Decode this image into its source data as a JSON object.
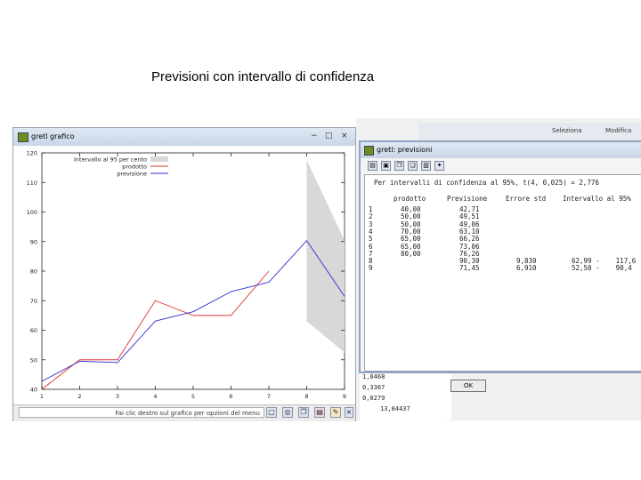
{
  "slide": {
    "title": "Previsioni con intervallo di confidenza"
  },
  "background_app": {
    "toolbar_items": [
      "Seleziona",
      "Modifica"
    ],
    "console_lines": [
      "1,0468",
      "0,3367",
      "0,0279",
      "13,84437"
    ]
  },
  "graph_window": {
    "title": "gretl grafico",
    "status_text": "Fai clic destro sul grafico per opzioni del menu",
    "window_controls": [
      "−",
      "□",
      "×"
    ],
    "toolbar_icons": [
      "zoom-icon",
      "crosshair-icon",
      "copy-icon",
      "pdf-icon",
      "edit-icon",
      "close-icon"
    ]
  },
  "chart_data": {
    "type": "line",
    "x": [
      1,
      2,
      3,
      4,
      5,
      6,
      7,
      8,
      9
    ],
    "xlim": [
      1,
      9
    ],
    "ylim": [
      40,
      120
    ],
    "xticks": [
      "1",
      "2",
      "3",
      "4",
      "5",
      "6",
      "7",
      "8",
      "9"
    ],
    "yticks": [
      "40",
      "50",
      "60",
      "70",
      "80",
      "90",
      "100",
      "110",
      "120"
    ],
    "legend": [
      "Intervallo al 95 per cento",
      "prodotto",
      "previsione"
    ],
    "legend_position": "top-left",
    "series": [
      {
        "name": "prodotto",
        "color": "#e03030",
        "values": [
          40,
          50,
          50,
          70,
          65,
          65,
          80,
          null,
          null
        ]
      },
      {
        "name": "previsione",
        "color": "#3030d0",
        "values": [
          42.71,
          49.51,
          49.06,
          63.1,
          66.26,
          73.06,
          76.26,
          90.3,
          71.45
        ]
      }
    ],
    "interval": {
      "name": "Intervallo al 95 per cento",
      "color": "#d8d8d8",
      "x": [
        8,
        9
      ],
      "lower": [
        62.99,
        52.5
      ],
      "upper": [
        117.6,
        90.4
      ]
    }
  },
  "forecast_window": {
    "title": "gretl: previsioni",
    "header_line": "Per intervalli di confidenza al 95%, t(4, 0,025) = 2,776",
    "columns": [
      "prodotto",
      "Previsione",
      "Errore std",
      "Intervallo al 95%"
    ],
    "obs": [
      "1",
      "2",
      "3",
      "4",
      "5",
      "6",
      "7",
      "8",
      "9"
    ],
    "prodotto": [
      "40,00",
      "50,00",
      "50,00",
      "70,00",
      "65,00",
      "65,00",
      "80,00",
      "",
      ""
    ],
    "previsione": [
      "42,71",
      "49,51",
      "49,06",
      "63,10",
      "66,26",
      "73,06",
      "76,26",
      "90,30",
      "71,45"
    ],
    "errore_std": [
      "",
      "",
      "",
      "",
      "",
      "",
      "",
      "9,830",
      "6,910"
    ],
    "intervallo": [
      "",
      "",
      "",
      "",
      "",
      "",
      "",
      "62,99 -    117,6",
      "52,50 -    90,4"
    ],
    "toolbar_icons": [
      "print-icon",
      "save-icon",
      "copy-icon",
      "copy2-icon",
      "chart-icon",
      "help-icon"
    ],
    "ok_label": "OK"
  }
}
